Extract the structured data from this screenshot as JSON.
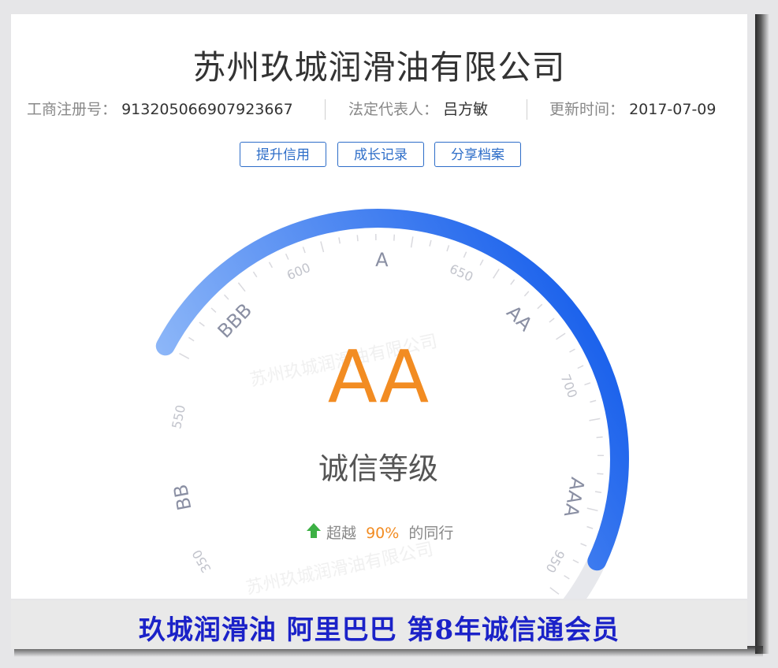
{
  "company": {
    "name": "苏州玖城润滑油有限公司"
  },
  "meta": {
    "reg_label": "工商注册号：",
    "reg_value": "913205066907923667",
    "legal_label": "法定代表人：",
    "legal_value": "吕方敏",
    "update_label": "更新时间：",
    "update_value": "2017-07-09"
  },
  "buttons": {
    "improve": "提升信用",
    "growth": "成长记录",
    "share": "分享档案"
  },
  "gauge": {
    "grade": "AA",
    "grade_caption": "诚信等级",
    "surpass_prefix": "超越",
    "surpass_value": "90%",
    "surpass_suffix": "的同行",
    "labels": [
      "BB",
      "BBB",
      "A",
      "AA",
      "AAA"
    ],
    "numbers": [
      "350",
      "550",
      "600",
      "650",
      "700",
      "950"
    ],
    "progress_fraction": 0.75,
    "colors": {
      "start": "#a8cbfb",
      "end": "#1d63ec",
      "track": "#e7e8ec",
      "grade": "#f28c22",
      "arrow": "#3cb044"
    }
  },
  "watermark": "苏州玖城润滑油有限公司",
  "footer": {
    "text": "玖城润滑油 阿里巴巴 第8年诚信通会员"
  }
}
